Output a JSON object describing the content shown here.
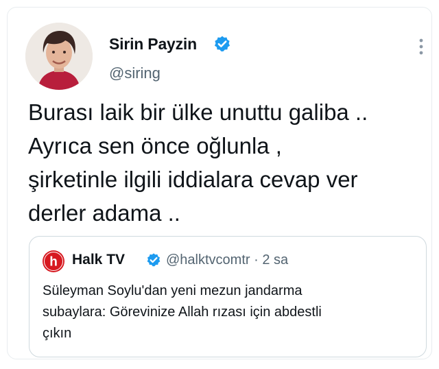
{
  "author": {
    "display_name": "Sirin Payzin",
    "handle": "@siring",
    "verified_icon": "verified-badge-icon",
    "verified_color": "#1d9bf0"
  },
  "menu": {
    "icon": "more-options-icon"
  },
  "tweet": {
    "lines": [
      "Burası laik bir ülke unuttu galiba ..",
      "Ayrıca sen önce oğlunla ,",
      "şirketinle ilgili iddialara cevap ver",
      "derler adama .."
    ]
  },
  "quote": {
    "display_name": "Halk TV",
    "meta": "@halktvcomtr · 2 sa",
    "logo_icon": "halktv-logo-icon",
    "logo_color": "#d71920",
    "lines": [
      "Süleyman Soylu'dan yeni mezun jandarma",
      "subaylara: Görevinize Allah rızası için abdestli",
      "çıkın"
    ]
  }
}
